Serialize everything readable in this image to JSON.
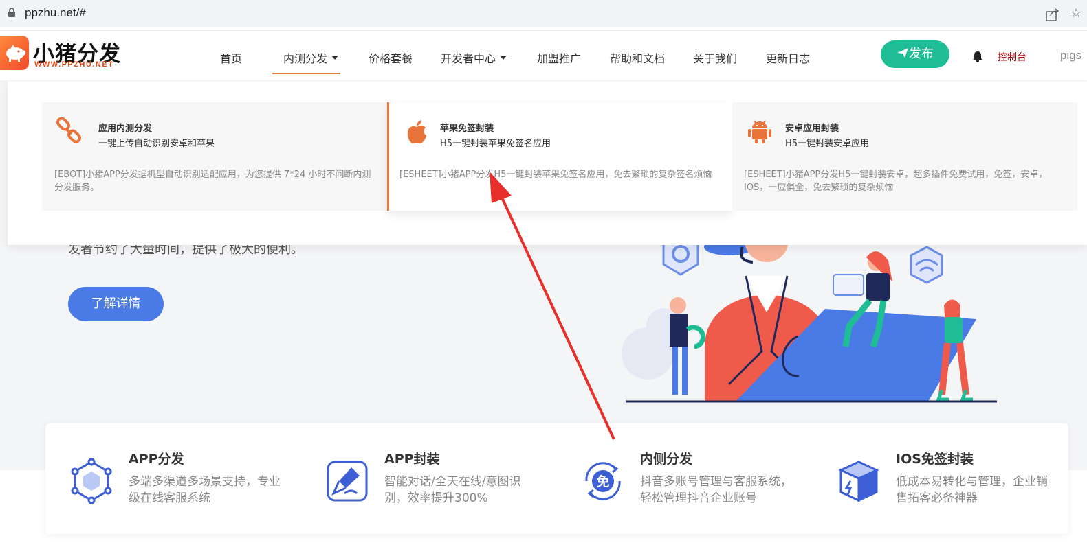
{
  "browser": {
    "url": "ppzhu.net/#"
  },
  "logo": {
    "title": "小猪分发",
    "subtitle": "WWW.PPZHU.NET"
  },
  "nav": {
    "items": [
      "首页",
      "内测分发",
      "价格套餐",
      "开发者中心",
      "加盟推广",
      "帮助和文档",
      "关于我们",
      "更新日志"
    ],
    "publish_label": "发布",
    "console_label": "控制台",
    "user": "pigs"
  },
  "dropdown": {
    "cards": [
      {
        "icon": "link-icon",
        "title": "应用内测分发",
        "subtitle": "一键上传自动识别安卓和苹果",
        "description": "[EBOT]小猪APP分发据机型自动识别适配应用，为您提供 7*24 小时不间断内测分发服务。"
      },
      {
        "icon": "apple-icon",
        "title": "苹果免签封装",
        "subtitle": "H5一键封装苹果免签名应用",
        "description": "[ESHEET]小猪APP分发H5一键封装苹果免签名应用，免去繁琐的复杂签名烦恼"
      },
      {
        "icon": "android-icon",
        "title": "安卓应用封装",
        "subtitle": "H5一键封装安卓应用",
        "description": "[ESHEET]小猪APP分发H5一键封装安卓，超多插件免费试用，免签，安卓，IOS，一应俱全，免去繁琐的复杂烦恼"
      }
    ]
  },
  "hero": {
    "text": "发者节约了大量时间，提供了极大的便利。",
    "button_label": "了解详情"
  },
  "features": [
    {
      "icon": "cube-network-icon",
      "title": "APP分发",
      "description": "多端多渠道多场景支持，专业级在线客服系统"
    },
    {
      "icon": "pen-icon",
      "title": "APP封装",
      "description": "智能对话/全天在线/意图识别，效率提升300%"
    },
    {
      "icon": "free-badge-icon",
      "title": "内侧分发",
      "description": "抖音多账号管理与客服系统，轻松管理抖音企业账号"
    },
    {
      "icon": "box-icon",
      "title": "IOS免签封装",
      "description": "低成本易转化与管理，企业销售拓客必备神器"
    }
  ],
  "colors": {
    "accent_orange": "#e8743b",
    "publish_green": "#1fbd95",
    "primary_blue": "#4a7ae6",
    "console_red": "#b8060b",
    "annotation_arrow": "#e8302a"
  }
}
